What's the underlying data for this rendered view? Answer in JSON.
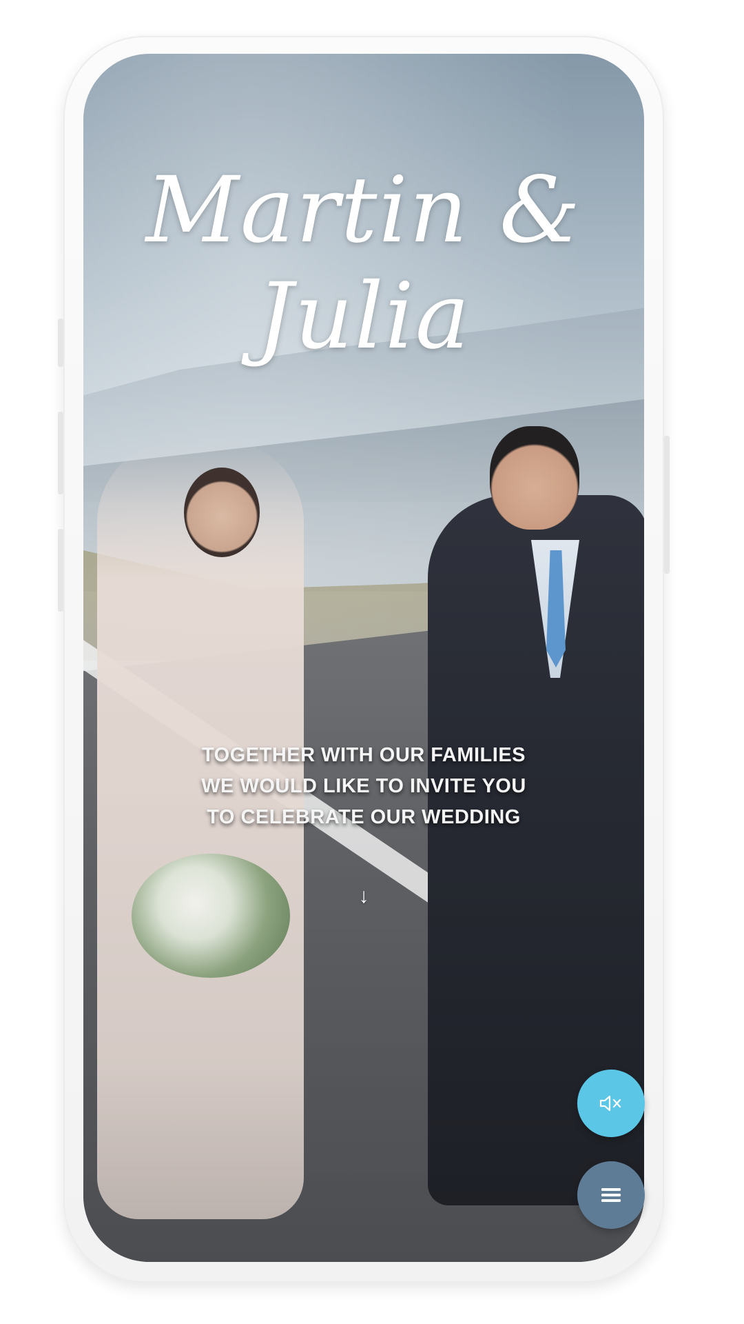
{
  "couple_names": "Martin & Julia",
  "invitation": {
    "line1": "TOGETHER WITH OUR FAMILIES",
    "line2": "WE WOULD LIKE TO INVITE YOU",
    "line3": "TO CELEBRATE OUR WEDDING"
  },
  "icons": {
    "scroll": "arrow-down-icon",
    "mute": "speaker-muted-icon",
    "menu": "hamburger-menu-icon"
  },
  "colors": {
    "mute_button": "#5cc6e6",
    "menu_button": "#5f7c96",
    "text": "#ffffff"
  }
}
